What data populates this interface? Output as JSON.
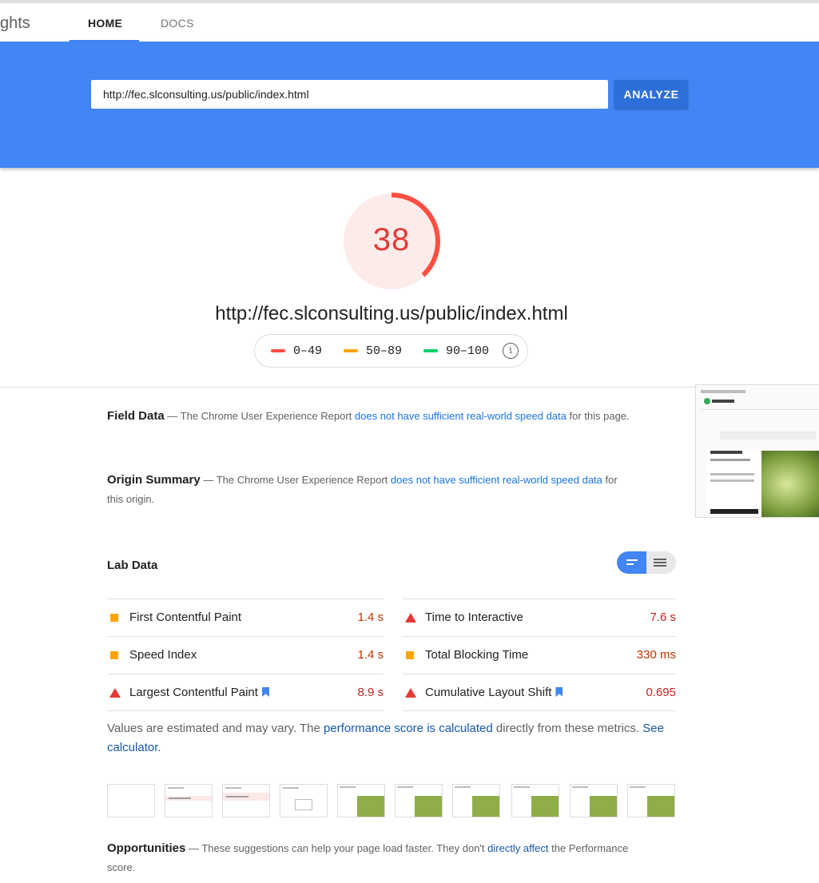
{
  "nav": {
    "brand": "ghts",
    "tabs": [
      "HOME",
      "DOCS"
    ]
  },
  "search": {
    "value": "http://fec.slconsulting.us/public/index.html",
    "button": "ANALYZE"
  },
  "score": {
    "value": "38",
    "url": "http://fec.slconsulting.us/public/index.html",
    "fraction": 0.38,
    "color": "#e53935"
  },
  "legend": [
    {
      "label": "0–49",
      "color": "#ff4e42"
    },
    {
      "label": "50–89",
      "color": "#ffa400"
    },
    {
      "label": "90–100",
      "color": "#0cce6b"
    }
  ],
  "field_data": {
    "title": "Field Data",
    "prefix": " — The Chrome User Experience Report ",
    "link": "does not have sufficient real-world speed data",
    "suffix": " for this page."
  },
  "origin_summary": {
    "title": "Origin Summary",
    "prefix": " — The Chrome User Experience Report ",
    "link": "does not have sufficient real-world speed data",
    "suffix": " for this origin."
  },
  "lab_data": {
    "title": "Lab Data",
    "metrics": [
      {
        "name": "First Contentful Paint",
        "value": "1.4 s",
        "status": "average",
        "bookmark": false
      },
      {
        "name": "Time to Interactive",
        "value": "7.6 s",
        "status": "fail",
        "bookmark": false
      },
      {
        "name": "Speed Index",
        "value": "1.4 s",
        "status": "average",
        "bookmark": false
      },
      {
        "name": "Total Blocking Time",
        "value": "330 ms",
        "status": "average",
        "bookmark": false
      },
      {
        "name": "Largest Contentful Paint",
        "value": "8.9 s",
        "status": "fail",
        "bookmark": true
      },
      {
        "name": "Cumulative Layout Shift",
        "value": "0.695",
        "status": "fail",
        "bookmark": true
      }
    ]
  },
  "note": {
    "prefix": "Values are estimated and may vary. The ",
    "link1": "performance score is calculated",
    "middle": " directly from these metrics. ",
    "link2": "See calculator."
  },
  "opportunities": {
    "title": "Opportunities",
    "prefix": " — These suggestions can help your page load faster. They don't ",
    "link": "directly affect",
    "suffix": " the Performance score."
  },
  "colors": {
    "fail": "#e53935",
    "average": "#ffa400",
    "fail_text": "#c7221f",
    "average_text": "#c33300",
    "accent": "#4285f4"
  }
}
